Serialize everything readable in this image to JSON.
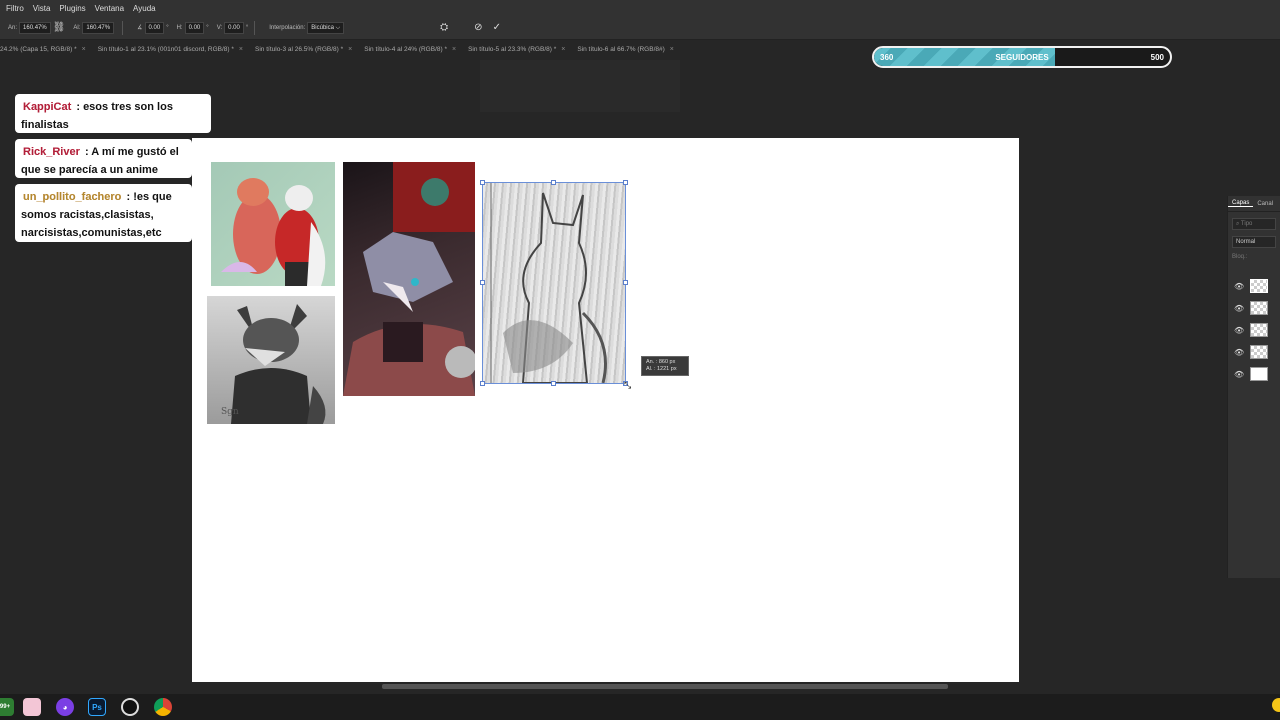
{
  "menu": [
    "Filtro",
    "Vista",
    "Plugins",
    "Ventana",
    "Ayuda"
  ],
  "options": {
    "w_label": "An:",
    "w_value": "160.47%",
    "link_icon": "link-icon",
    "h_label": "Al:",
    "h_value": "160.47%",
    "angle_label": "∡",
    "angle_value": "0.00",
    "angle_unit": "°",
    "hskew_label": "H:",
    "hskew_value": "0.00",
    "hskew_unit": "°",
    "vskew_label": "V:",
    "vskew_value": "0.00",
    "vskew_unit": "°",
    "interp_label": "Interpolación:",
    "interp_value": "Bicúbica ⌵"
  },
  "tabs": [
    "24.2% (Capa 15, RGB/8) *",
    "Sin título-1 al 23.1% (001n01 discord, RGB/8) *",
    "Sin título-3 al 26.5% (RGB/8) *",
    "Sin título-4 al 24% (RGB/8) *",
    "Sin título-5 al 23.3% (RGB/8) *",
    "Sin título-6 al 66.7% (RGB/8#)"
  ],
  "followers": {
    "current": "360",
    "goal": "500",
    "label": "SEGUIDORES",
    "progress": 0.61
  },
  "chat": [
    {
      "user": "KappiCat",
      "line1": ": esos tres son los",
      "line2": "finalistas"
    },
    {
      "user": "Rick_River",
      "line1": ": A mí me gustó el",
      "line2": "que se parecía a un anime"
    },
    {
      "user": "un_pollito_fachero",
      "line1": ": !es que",
      "line2": "somos racistas,clasistas,",
      "line3": "narcisistas,comunistas,etc"
    }
  ],
  "tooltip": {
    "w": "An. :    860 px",
    "h": "Al. :   1221 px"
  },
  "layers_panel": {
    "tab_layers": "Capas",
    "tab_channels": "Canal",
    "search": "Tipo",
    "blend": "Normal",
    "lock": "Bloq.:"
  },
  "taskbar": {
    "badge": "99+",
    "ps_label": "Ps"
  }
}
